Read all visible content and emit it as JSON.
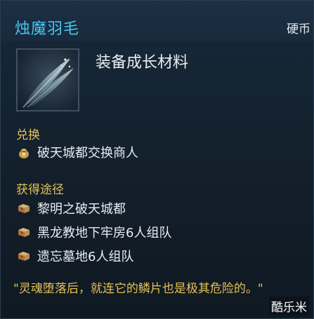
{
  "item": {
    "name": "烛魔羽毛",
    "currency": "硬币",
    "type": "装备成长材料",
    "icon": "feather-icon"
  },
  "exchange": {
    "heading": "兑换",
    "entries": [
      {
        "icon": "coin-bag-icon",
        "label": "破天城都交换商人"
      }
    ]
  },
  "acquire": {
    "heading": "获得途径",
    "entries": [
      {
        "icon": "map-scroll-icon",
        "label": "黎明之破天城都"
      },
      {
        "icon": "map-scroll-icon",
        "label": "黑龙教地下牢房6人组队"
      },
      {
        "icon": "map-scroll-icon",
        "label": "遗忘墓地6人组队"
      }
    ]
  },
  "flavor_text": "\"灵魂堕落后，就连它的鳞片也是极其危险的。\"",
  "watermark": "酷乐米",
  "colors": {
    "title": "#49c4ee",
    "heading": "#e4c156",
    "body_text": "#e8ecf1",
    "panel": "#14222f"
  }
}
